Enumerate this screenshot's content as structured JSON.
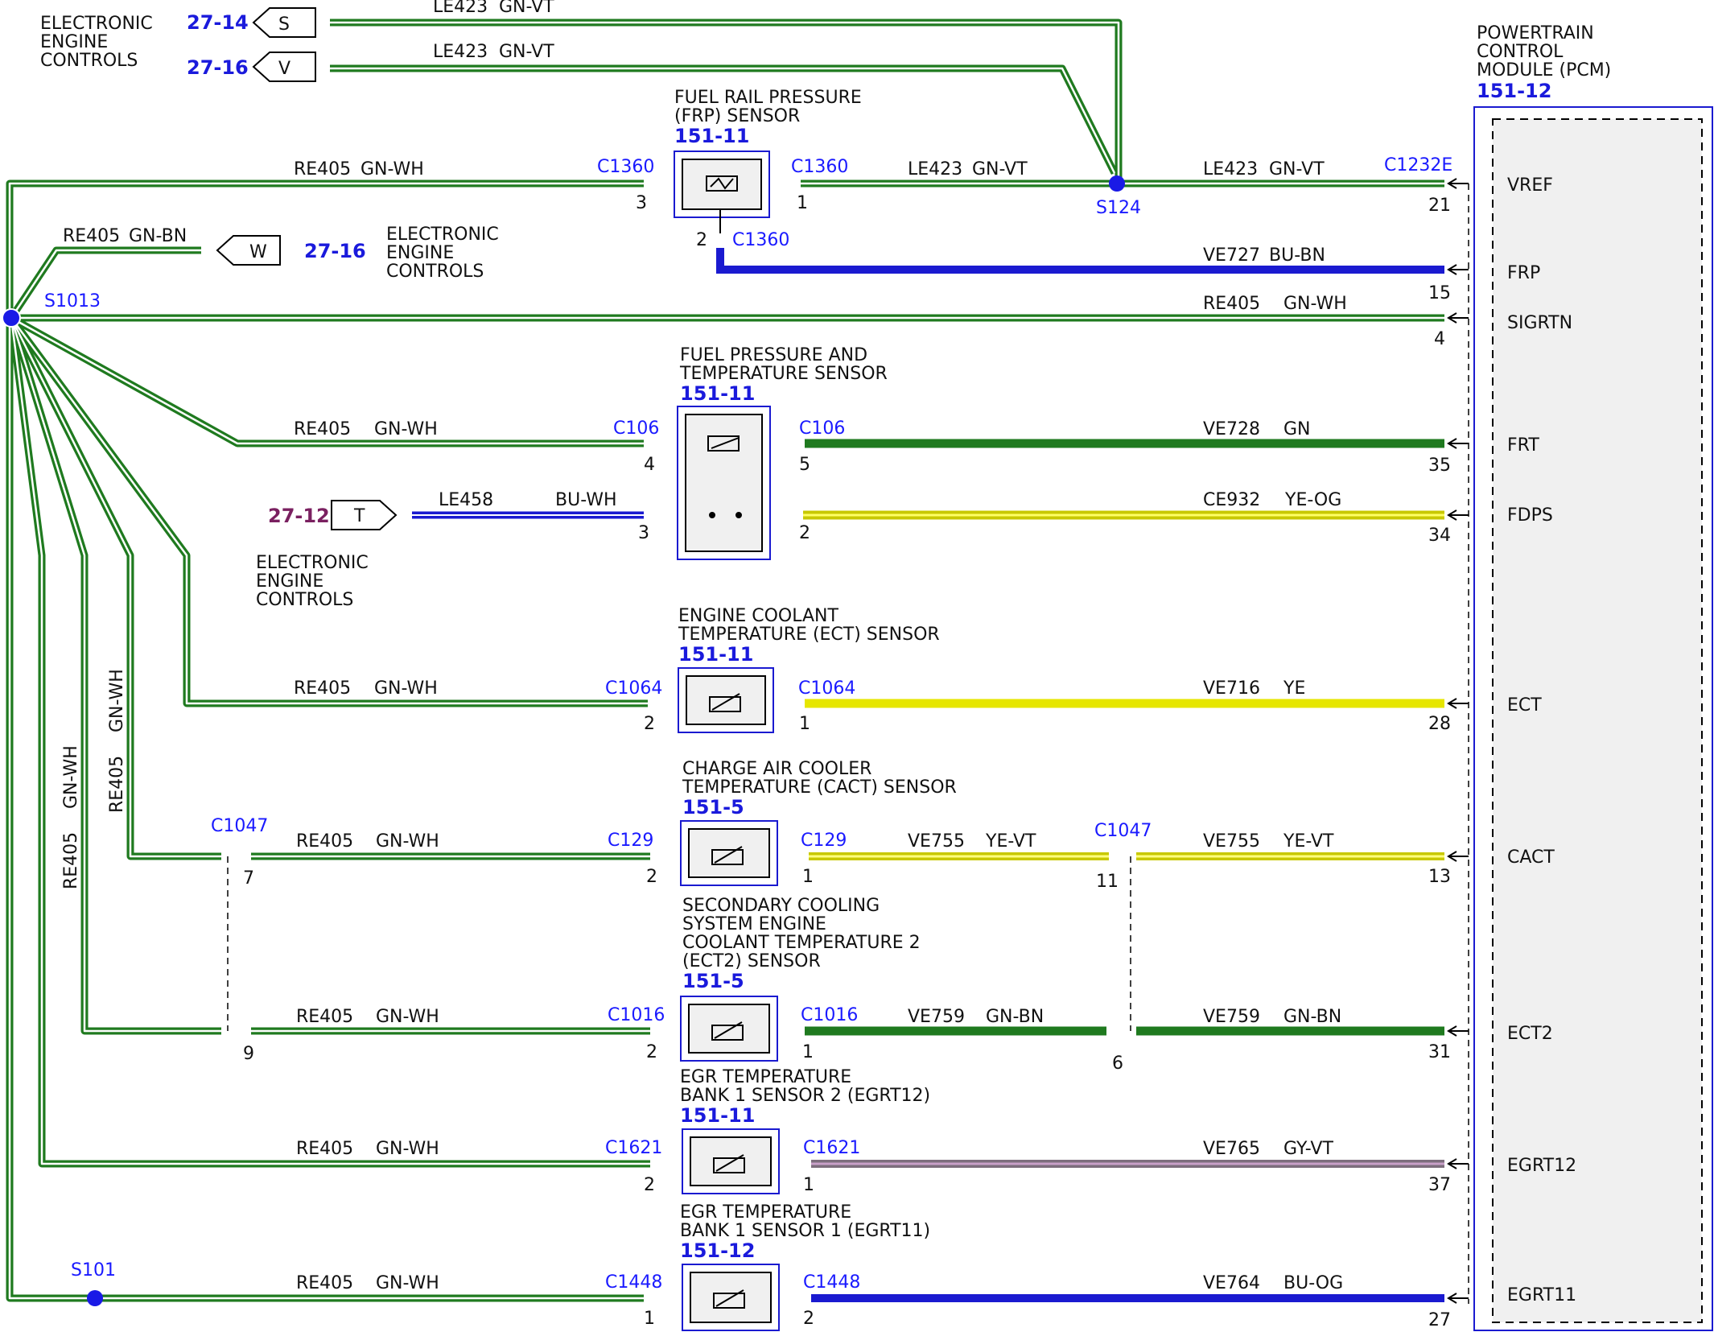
{
  "top_left": {
    "label_lines": [
      "ELECTRONIC",
      "ENGINE",
      "CONTROLS"
    ],
    "connectors": [
      {
        "ref": "27-14",
        "tag": "S",
        "wire": "LE423",
        "color": "GN-VT"
      },
      {
        "ref": "27-16",
        "tag": "V",
        "wire": "LE423",
        "color": "GN-VT"
      }
    ]
  },
  "mid_connector": {
    "ref": "27-16",
    "tag": "W",
    "wire": "RE405",
    "color": "GN-BN",
    "label_lines": [
      "ELECTRONIC",
      "ENGINE",
      "CONTROLS"
    ]
  },
  "t_connector": {
    "ref": "27-12",
    "tag": "T",
    "wire": "LE458",
    "color": "BU-WH",
    "label_lines": [
      "ELECTRONIC",
      "ENGINE",
      "CONTROLS"
    ]
  },
  "splices": {
    "s1013": "S1013",
    "s124": "S124",
    "s101": "S101"
  },
  "pcm": {
    "title_lines": [
      "POWERTRAIN",
      "CONTROL",
      "MODULE (PCM)"
    ],
    "ref": "151-12",
    "connector": "C1232E",
    "pins": [
      {
        "name": "VREF",
        "pin": "21"
      },
      {
        "name": "FRP",
        "pin": "15"
      },
      {
        "name": "SIGRTN",
        "pin": "4"
      },
      {
        "name": "FRT",
        "pin": "35"
      },
      {
        "name": "FDPS",
        "pin": "34"
      },
      {
        "name": "ECT",
        "pin": "28"
      },
      {
        "name": "CACT",
        "pin": "13"
      },
      {
        "name": "ECT2",
        "pin": "31"
      },
      {
        "name": "EGRT12",
        "pin": "37"
      },
      {
        "name": "EGRT11",
        "pin": "27"
      }
    ]
  },
  "frp_sensor": {
    "title_lines": [
      "FUEL RAIL PRESSURE",
      "(FRP) SENSOR"
    ],
    "ref": "151-11",
    "connector": "C1360",
    "pin_left": "3",
    "pin_right": "1",
    "pin_bottom": "2",
    "left_wire": "RE405",
    "left_color": "GN-WH",
    "right_wire": "LE423",
    "right_color": "GN-VT",
    "pcm_wire": "LE423",
    "pcm_color": "GN-VT",
    "signal_wire": "VE727",
    "signal_color": "BU-BN"
  },
  "sigrtn_wire": {
    "wire": "RE405",
    "color": "GN-WH"
  },
  "fpt_sensor": {
    "title_lines": [
      "FUEL PRESSURE AND",
      "TEMPERATURE SENSOR"
    ],
    "ref": "151-11",
    "connector": "C106",
    "pin_l1": "4",
    "pin_r1": "5",
    "pin_l2": "3",
    "pin_r2": "2",
    "left_wire": "RE405",
    "left_color": "GN-WH",
    "frt_wire": "VE728",
    "frt_color": "GN",
    "fdps_wire": "CE932",
    "fdps_color": "YE-OG"
  },
  "sensors": [
    {
      "key": "ect",
      "title_lines": [
        "ENGINE COOLANT",
        "TEMPERATURE (ECT) SENSOR"
      ],
      "ref": "151-11",
      "connector": "C1064",
      "pin_left": "2",
      "pin_right": "1",
      "left_wire": "RE405",
      "left_color": "GN-WH",
      "right_wire": "VE716",
      "right_color": "YE"
    },
    {
      "key": "cact",
      "title_lines": [
        "CHARGE AIR COOLER",
        "TEMPERATURE (CACT) SENSOR"
      ],
      "ref": "151-5",
      "connector": "C129",
      "pin_left": "2",
      "pin_right": "1",
      "left_wire": "RE405",
      "left_color": "GN-WH",
      "right_wire": "VE755",
      "right_color": "YE-VT",
      "right_wire2": "VE755",
      "right_color2": "YE-VT"
    },
    {
      "key": "ect2",
      "title_lines": [
        "SECONDARY COOLING",
        "SYSTEM ENGINE",
        "COOLANT TEMPERATURE 2",
        "(ECT2) SENSOR"
      ],
      "ref": "151-5",
      "connector": "C1016",
      "pin_left": "2",
      "pin_right": "1",
      "left_wire": "RE405",
      "left_color": "GN-WH",
      "right_wire": "VE759",
      "right_color": "GN-BN",
      "right_wire2": "VE759",
      "right_color2": "GN-BN"
    },
    {
      "key": "egrt12",
      "title_lines": [
        "EGR TEMPERATURE",
        "BANK 1 SENSOR 2 (EGRT12)"
      ],
      "ref": "151-11",
      "connector": "C1621",
      "pin_left": "2",
      "pin_right": "1",
      "left_wire": "RE405",
      "left_color": "GN-WH",
      "right_wire": "VE765",
      "right_color": "GY-VT"
    },
    {
      "key": "egrt11",
      "title_lines": [
        "EGR TEMPERATURE",
        "BANK 1 SENSOR 1 (EGRT11)"
      ],
      "ref": "151-12",
      "connector": "C1448",
      "pin_left": "1",
      "pin_right": "2",
      "left_wire": "RE405",
      "left_color": "GN-WH",
      "right_wire": "VE764",
      "right_color": "BU-OG"
    }
  ],
  "inline_c1047": {
    "connector": "C1047",
    "pin_cact_left": "7",
    "pin_ect2_left": "9",
    "pin_cact_right": "11",
    "pin_ect2_right": "6"
  },
  "vertical_labels": {
    "a_wire": "RE405",
    "a_color": "GN-WH",
    "b_wire": "RE405",
    "b_color": "GN-WH"
  },
  "colors": {
    "green": "#1f7a1f",
    "blue": "#1a1ad0",
    "yellow": "#e6e600",
    "gray_violet": "#8f7f8f",
    "label_blue": "#1a1aff",
    "ref_purple": "#7a2060"
  }
}
